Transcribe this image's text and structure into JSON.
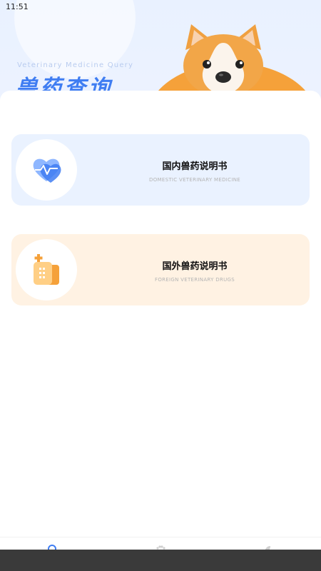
{
  "status_bar": {
    "time": "11:51"
  },
  "header": {
    "subtitle_en": "Veterinary Medicine Query",
    "title_cn": "兽药查询"
  },
  "cards": [
    {
      "title": "国内兽药说明书",
      "subtitle": "DOMESTIC VETERINARY MEDICINE",
      "icon": "heart-pulse-icon",
      "color": "#eaf2ff"
    },
    {
      "title": "国外兽药说明书",
      "subtitle": "FOREIGN VETERINARY DRUGS",
      "icon": "hospital-building-icon",
      "color": "#fff2e3"
    }
  ],
  "bottom_nav": {
    "items": [
      {
        "icon": "search-icon",
        "active": true,
        "color": "#3f7df2"
      },
      {
        "icon": "paw-icon",
        "active": false
      },
      {
        "icon": "leaf-icon",
        "active": false
      }
    ]
  },
  "colors": {
    "accent_blue": "#3f7df2",
    "accent_orange": "#f5a13a"
  }
}
